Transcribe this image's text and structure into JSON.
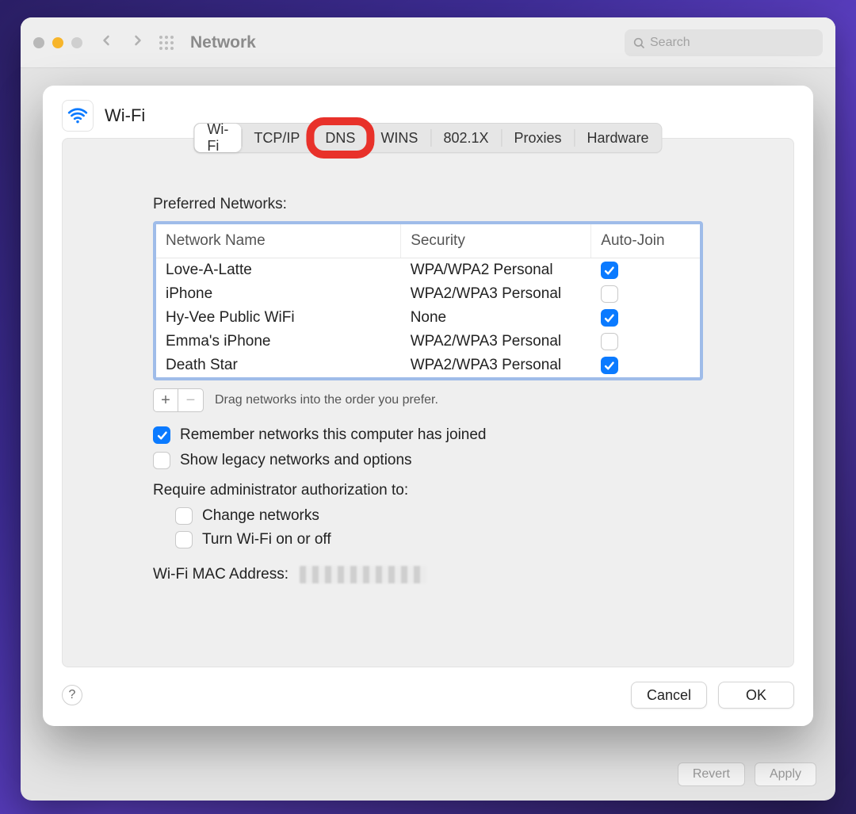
{
  "window": {
    "title": "Network",
    "search_placeholder": "Search"
  },
  "sheet": {
    "title": "Wi-Fi",
    "tabs": [
      "Wi-Fi",
      "TCP/IP",
      "DNS",
      "WINS",
      "802.1X",
      "Proxies",
      "Hardware"
    ],
    "active_tab_index": 0,
    "highlighted_tab_index": 2,
    "preferred_label": "Preferred Networks:",
    "columns": {
      "name": "Network Name",
      "security": "Security",
      "auto": "Auto-Join"
    },
    "networks": [
      {
        "name": "Love-A-Latte",
        "security": "WPA/WPA2 Personal",
        "auto_join": true
      },
      {
        "name": "iPhone",
        "security": "WPA2/WPA3 Personal",
        "auto_join": false
      },
      {
        "name": "Hy-Vee Public WiFi",
        "security": "None",
        "auto_join": true
      },
      {
        "name": "Emma's iPhone",
        "security": "WPA2/WPA3 Personal",
        "auto_join": false
      },
      {
        "name": "Death Star",
        "security": "WPA2/WPA3 Personal",
        "auto_join": true
      }
    ],
    "drag_hint": "Drag networks into the order you prefer.",
    "remember_label": "Remember networks this computer has joined",
    "remember_checked": true,
    "legacy_label": "Show legacy networks and options",
    "legacy_checked": false,
    "admin_label": "Require administrator authorization to:",
    "admin_change_label": "Change networks",
    "admin_change_checked": false,
    "admin_wifi_label": "Turn Wi-Fi on or off",
    "admin_wifi_checked": false,
    "mac_label": "Wi-Fi MAC Address:",
    "buttons": {
      "cancel": "Cancel",
      "ok": "OK",
      "help": "?"
    },
    "plus": "+",
    "minus": "−"
  },
  "footer": {
    "revert": "Revert",
    "apply": "Apply"
  }
}
